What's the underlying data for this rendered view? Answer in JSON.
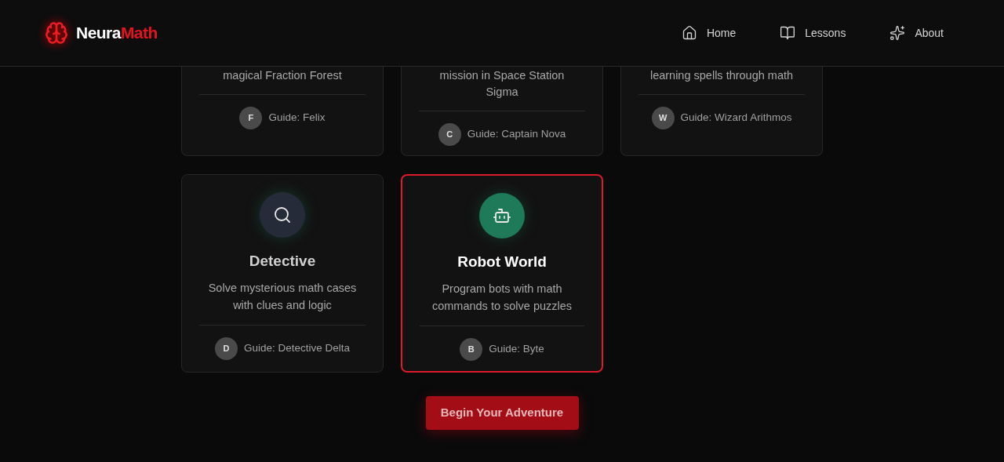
{
  "header": {
    "logo": {
      "first": "Neura",
      "second": "Math"
    },
    "nav": [
      {
        "label": "Home",
        "kind": "home"
      },
      {
        "label": "Lessons",
        "kind": "book"
      },
      {
        "label": "About",
        "kind": "sparkles"
      }
    ]
  },
  "worlds": [
    {
      "description_tail": [
        "magical Fraction Forest"
      ],
      "guide_initial": "F",
      "guide": "Guide: Felix",
      "selected": false
    },
    {
      "description_tail": [
        "mission in Space Station",
        "Sigma"
      ],
      "guide_initial": "C",
      "guide": "Guide: Captain Nova",
      "selected": false
    },
    {
      "description_tail": [
        "learning spells through math"
      ],
      "guide_initial": "W",
      "guide": "Guide: Wizard Arithmos",
      "selected": false
    },
    {
      "kind": "search",
      "color": "#262b3a",
      "title": "Detective",
      "description": "Solve mysterious math cases with clues and logic",
      "guide_initial": "D",
      "guide": "Guide: Detective Delta",
      "selected": false
    },
    {
      "kind": "robot",
      "color": "#1f7a5a",
      "title": "Robot World",
      "description": "Program bots with math commands to solve puzzles",
      "guide_initial": "B",
      "guide": "Guide: Byte",
      "selected": true
    }
  ],
  "cta": "Begin Your Adventure"
}
